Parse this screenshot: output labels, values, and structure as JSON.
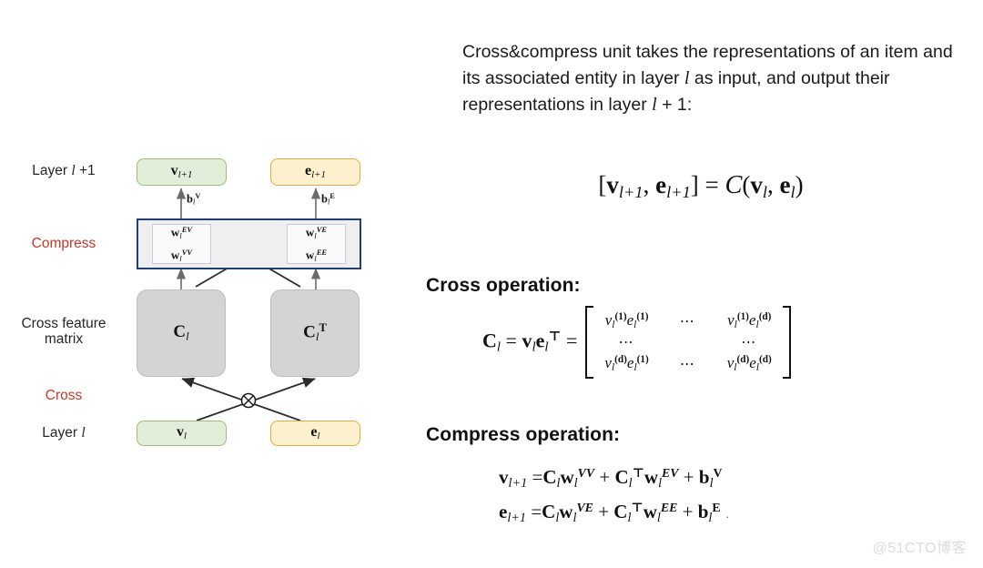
{
  "diagram": {
    "row_labels": [
      {
        "id": "layer-l-plus-1",
        "text": "Layer l +1",
        "color": "#262626"
      },
      {
        "id": "compress",
        "text": "Compress",
        "color": "#c0392b"
      },
      {
        "id": "cross-feature-matrix",
        "text": "Cross feature matrix",
        "color": "#262626"
      },
      {
        "id": "cross",
        "text": "Cross",
        "color": "#c0392b"
      },
      {
        "id": "layer-l",
        "text": "Layer l",
        "color": "#262626"
      }
    ],
    "nodes": {
      "v_next": {
        "label": "v l+1",
        "fill": "#e2eeda",
        "stroke": "#9cbb84"
      },
      "e_next": {
        "label": "e l+1",
        "fill": "#fdf0cf",
        "stroke": "#d9ae47"
      },
      "c_l": {
        "label": "C l",
        "fill": "#d4d4d4",
        "stroke": "#bdbdbd"
      },
      "c_l_t": {
        "label": "C l T",
        "fill": "#d4d4d4",
        "stroke": "#bdbdbd"
      },
      "v_l": {
        "label": "v l",
        "fill": "#e2eeda",
        "stroke": "#9cbb84"
      },
      "e_l": {
        "label": "e l",
        "fill": "#fdf0cf",
        "stroke": "#d9ae47"
      }
    },
    "compress_box": {
      "fill": "#efefef",
      "stroke": "#1f3f73"
    },
    "weights_left": [
      "w l EV",
      "w l VV"
    ],
    "weights_right": [
      "w l VE",
      "w l EE"
    ],
    "biases": {
      "left": "b l V",
      "right": "b l E"
    },
    "cross_symbol": "tensor-product"
  },
  "right": {
    "intro": "Cross&compress unit takes the representations of an item and its associated entity in layer l as input, and output their representations in layer l + 1:",
    "main_equation": "[v_{l+1}, e_{l+1}] = C(v_l, e_l)",
    "cross_heading": "Cross operation:",
    "cross_equation_lhs": "C_l = v_l e_l^T =",
    "cross_matrix": {
      "rows": [
        [
          "v_l^(1) e_l^(1)",
          "...",
          "v_l^(1) e_l^(d)"
        ],
        [
          "...",
          "",
          "..."
        ],
        [
          "v_l^(d) e_l^(1)",
          "...",
          "v_l^(d) e_l^(d)"
        ]
      ]
    },
    "compress_heading": "Compress operation:",
    "compress_equations": [
      "v_{l+1} = C_l w_l^{VV} + C_l^T w_l^{EV} + b_l^V",
      "e_{l+1} = C_l w_l^{VE} + C_l^T w_l^{EE} + b_l^E"
    ]
  },
  "watermark": "@51CTO博客"
}
